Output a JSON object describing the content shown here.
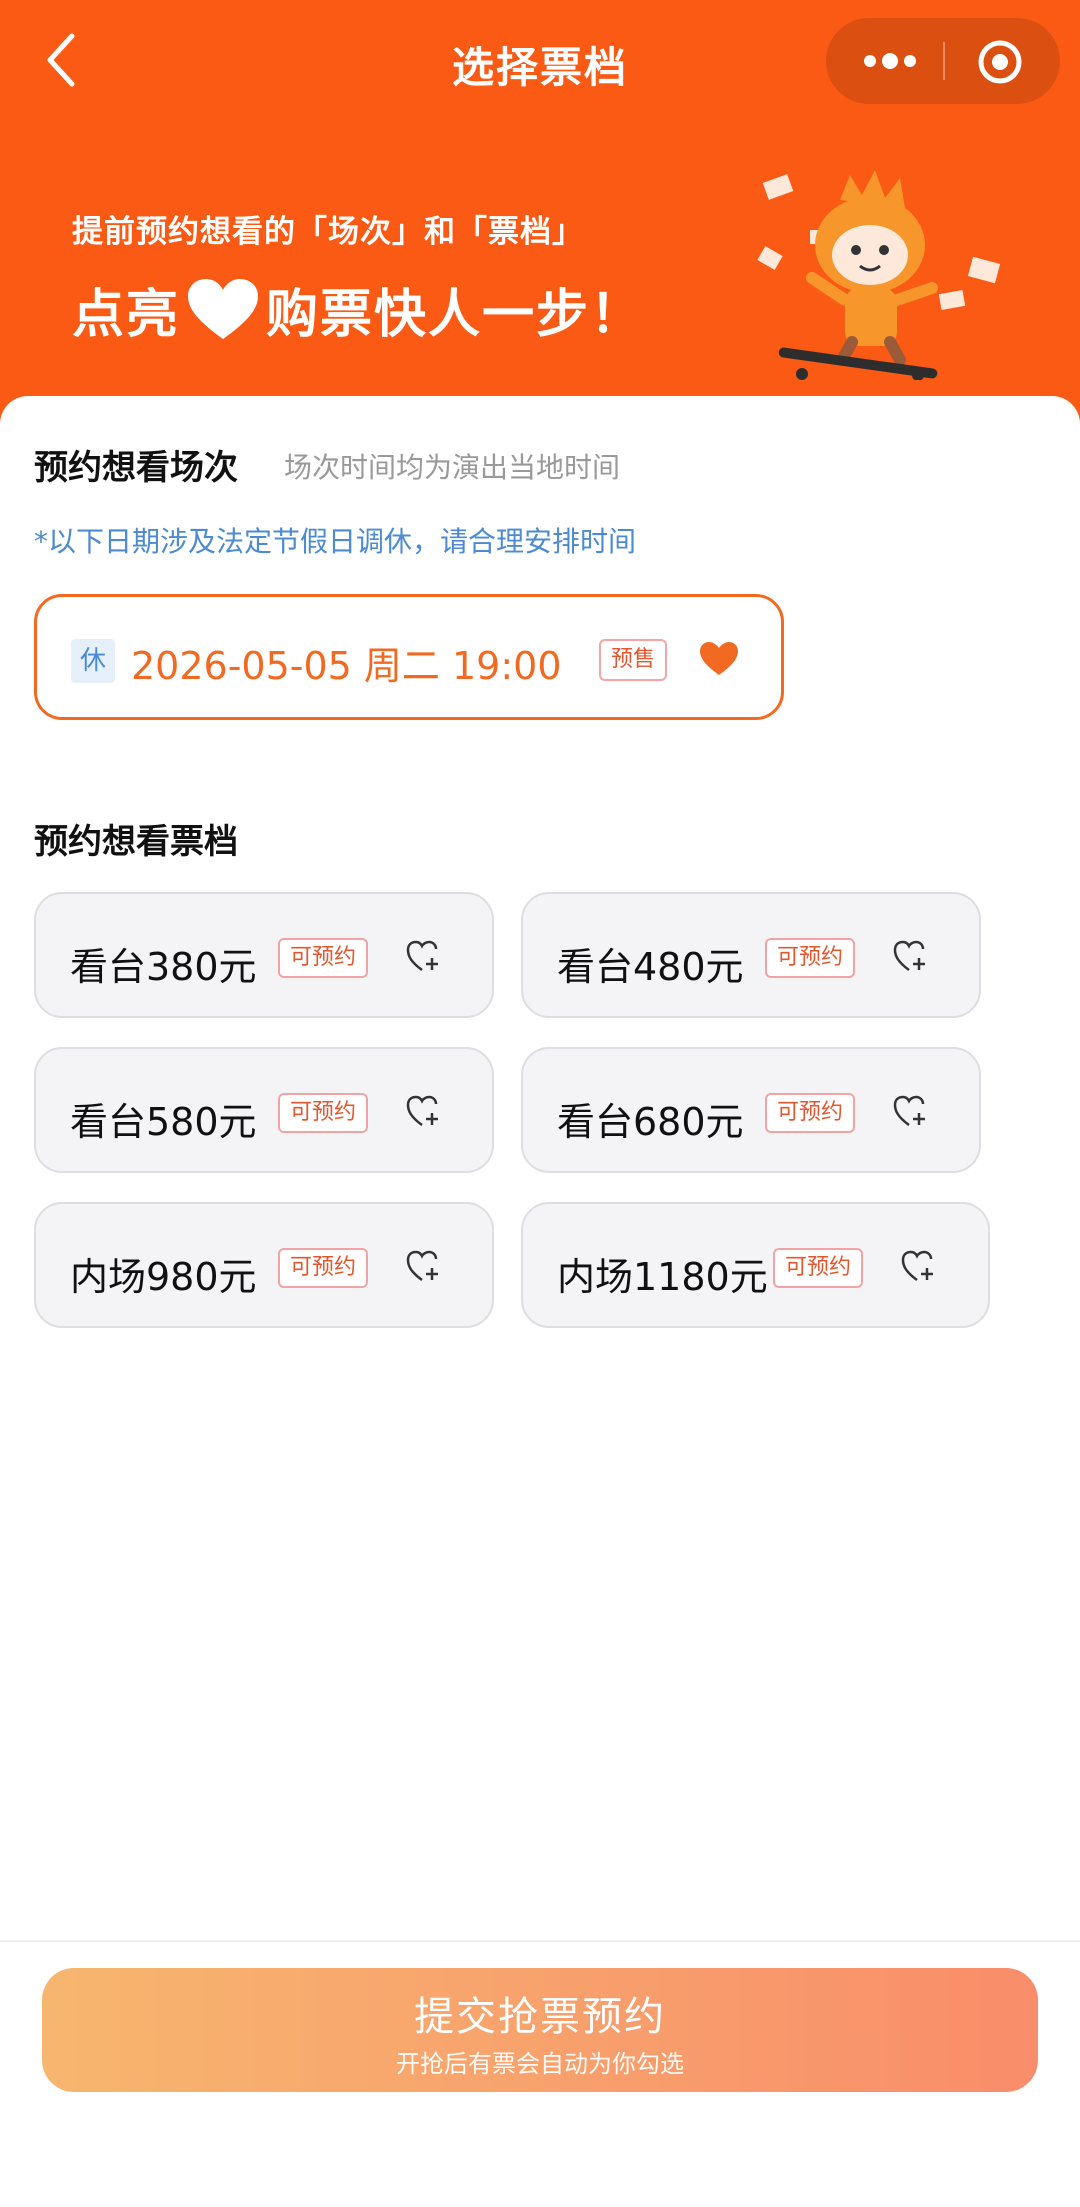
{
  "header": {
    "title": "选择票档",
    "back_icon": "chevron-left-icon",
    "more_icon": "more-dots-icon",
    "close_icon": "target-icon",
    "background": "#fa5a14"
  },
  "promo": {
    "line1": "提前预约想看的「场次」和「票档」",
    "line2_part1": "点亮",
    "line2_part2": "购票快人一步！"
  },
  "session_section": {
    "title": "预约想看场次",
    "hint": "场次时间均为演出当地时间",
    "holiday_note": "*以下日期涉及法定节假日调休，请合理安排时间",
    "session": {
      "rest_tag": "休",
      "datetime": "2026-05-05 周二 19:00",
      "status": "预售",
      "selected": true
    }
  },
  "tier_section": {
    "title": "预约想看票档",
    "tiers": [
      {
        "label": "看台380元",
        "status": "可预约"
      },
      {
        "label": "看台480元",
        "status": "可预约"
      },
      {
        "label": "看台580元",
        "status": "可预约"
      },
      {
        "label": "看台680元",
        "status": "可预约"
      },
      {
        "label": "内场980元",
        "status": "可预约"
      },
      {
        "label": "内场1180元",
        "status": "可预约"
      }
    ]
  },
  "submit": {
    "label": "提交抢票预约",
    "sub_label": "开抢后有票会自动为你勾选"
  },
  "colors": {
    "accent": "#f26a22",
    "note_blue": "#4c8bd1",
    "tag_red": "#e4572e"
  }
}
